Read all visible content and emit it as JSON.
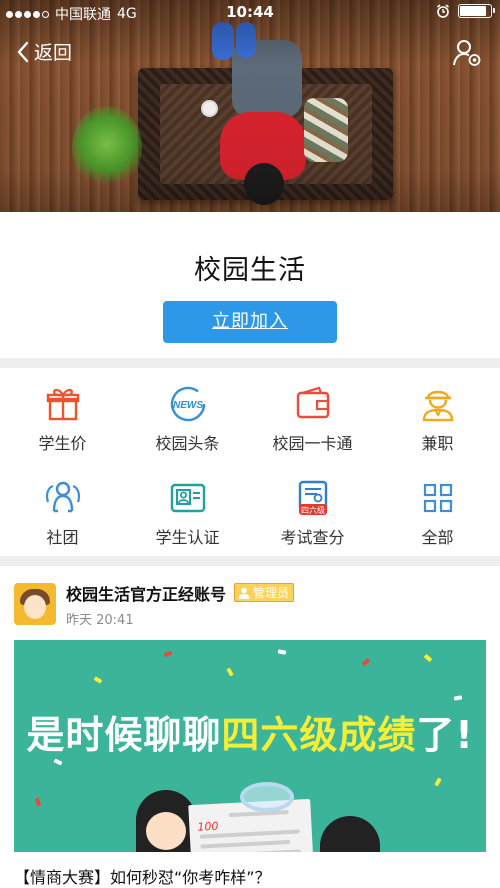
{
  "status_bar": {
    "carrier": "中国联通",
    "network": "4G",
    "time": "10:44",
    "battery_level": 0.85
  },
  "nav": {
    "back_label": "返回",
    "settings_icon": "user-settings-icon"
  },
  "header": {
    "title": "校园生活",
    "join_button": "立即加入"
  },
  "grid": {
    "items": [
      {
        "label": "学生价",
        "icon": "gift-icon",
        "color": "#f0522b"
      },
      {
        "label": "校园头条",
        "icon": "news-icon",
        "color": "#2f8fd8"
      },
      {
        "label": "校园一卡通",
        "icon": "wallet-card-icon",
        "color": "#ef4a3b"
      },
      {
        "label": "兼职",
        "icon": "worker-icon",
        "color": "#f2a71f"
      },
      {
        "label": "社团",
        "icon": "club-people-icon",
        "color": "#3a8fd8"
      },
      {
        "label": "学生认证",
        "icon": "id-card-icon",
        "color": "#20a29a"
      },
      {
        "label": "考试查分",
        "icon": "exam-score-icon",
        "color": "#2f7fd0",
        "badge": "四六级"
      },
      {
        "label": "全部",
        "icon": "all-grid-icon",
        "color": "#3a8fd8"
      }
    ]
  },
  "post": {
    "author": "校园生活官方正经账号",
    "badge": "管理员",
    "timestamp": "昨天 20:41",
    "banner": {
      "text_prefix": "是时候聊聊",
      "text_highlight": "四六级成绩",
      "text_suffix": "了!",
      "paper_score": "100"
    },
    "title": "【情商大赛】如何秒怼“你考咋样”？"
  }
}
